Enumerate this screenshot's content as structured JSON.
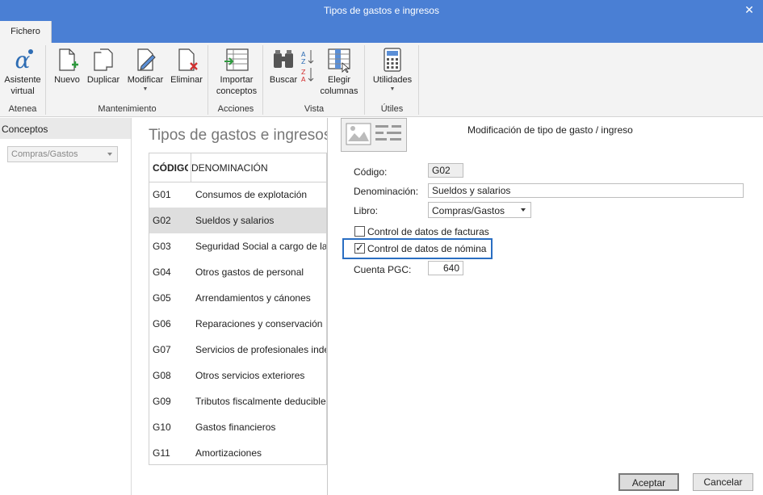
{
  "window": {
    "title": "Tipos de gastos e ingresos"
  },
  "tabs": [
    {
      "label": "Fichero"
    }
  ],
  "ribbon": {
    "groups": [
      {
        "label": "Atenea",
        "buttons": [
          {
            "label": "Asistente\nvirtual",
            "icon": "alpha-icon"
          }
        ]
      },
      {
        "label": "Mantenimiento",
        "buttons": [
          {
            "label": "Nuevo",
            "icon": "new-document-icon"
          },
          {
            "label": "Duplicar",
            "icon": "duplicate-icon"
          },
          {
            "label": "Modificar",
            "icon": "edit-document-icon"
          },
          {
            "label": "Eliminar",
            "icon": "delete-document-icon"
          }
        ]
      },
      {
        "label": "Acciones",
        "buttons": [
          {
            "label": "Importar\nconceptos",
            "icon": "import-icon"
          }
        ]
      },
      {
        "label": "Vista",
        "buttons": [
          {
            "label": "Buscar",
            "icon": "binoculars-icon"
          },
          {
            "label": "",
            "icon": "sort-icon"
          },
          {
            "label": "Elegir\ncolumnas",
            "icon": "choose-columns-icon"
          }
        ]
      },
      {
        "label": "Útiles",
        "buttons": [
          {
            "label": "Utilidades",
            "icon": "calculator-icon"
          }
        ]
      }
    ]
  },
  "left_pane": {
    "header": "Conceptos",
    "select_value": "Compras/Gastos"
  },
  "main": {
    "title": "Tipos de gastos e ingresos",
    "columns": [
      "CÓDIGO",
      "DENOMINACIÓN"
    ],
    "rows": [
      {
        "code": "G01",
        "name": "Consumos de explotación"
      },
      {
        "code": "G02",
        "name": "Sueldos y salarios"
      },
      {
        "code": "G03",
        "name": "Seguridad Social a cargo de la empresa"
      },
      {
        "code": "G04",
        "name": "Otros gastos de personal"
      },
      {
        "code": "G05",
        "name": "Arrendamientos y cánones"
      },
      {
        "code": "G06",
        "name": "Reparaciones y conservación"
      },
      {
        "code": "G07",
        "name": "Servicios de profesionales independientes"
      },
      {
        "code": "G08",
        "name": "Otros servicios exteriores"
      },
      {
        "code": "G09",
        "name": "Tributos fiscalmente deducibles"
      },
      {
        "code": "G10",
        "name": "Gastos financieros"
      },
      {
        "code": "G11",
        "name": "Amortizaciones"
      }
    ],
    "selected_row": "G02"
  },
  "dialog": {
    "title": "Modificación de tipo de gasto / ingreso",
    "fields": {
      "codigo_label": "Código:",
      "codigo_value": "G02",
      "denominacion_label": "Denominación:",
      "denominacion_value": "Sueldos y salarios",
      "libro_label": "Libro:",
      "libro_value": "Compras/Gastos",
      "control_facturas_label": "Control de datos de facturas",
      "control_facturas_checked": false,
      "control_nomina_label": "Control de datos de nómina",
      "control_nomina_checked": true,
      "cuenta_label": "Cuenta PGC:",
      "cuenta_value": "640"
    },
    "buttons": {
      "accept": "Aceptar",
      "cancel": "Cancelar"
    }
  },
  "colors": {
    "titlebar": "#4a7fd4",
    "highlight": "#2a6ec2",
    "selected_row": "#dedede"
  }
}
